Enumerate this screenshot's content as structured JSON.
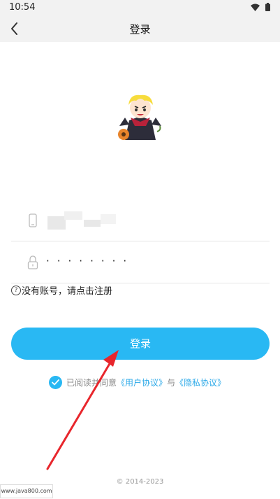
{
  "status": {
    "time": "10:54"
  },
  "nav": {
    "title": "登录"
  },
  "form": {
    "password_mask": "········",
    "register_text": "没有账号，请点击注册",
    "login_label": "登录"
  },
  "agreement": {
    "prefix": "已阅读并同意",
    "user_agreement": "《用户协议》",
    "and": "与",
    "privacy_agreement": "《隐私协议》"
  },
  "footer": {
    "copyright": "© 2014-2023"
  },
  "watermark": {
    "text": "www.java800.com"
  },
  "colors": {
    "accent": "#29b8f3",
    "arrow": "#e8262c"
  }
}
